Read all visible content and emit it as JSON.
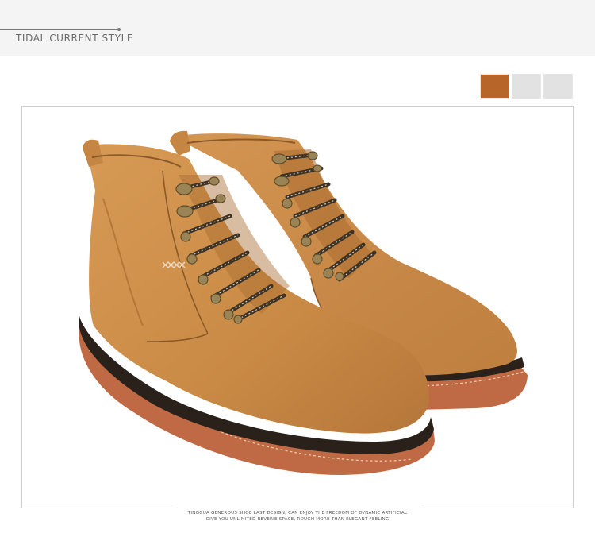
{
  "header": {
    "title": "TIDAL CURRENT STYLE"
  },
  "color_options": [
    {
      "name": "tan",
      "color": "#b8652a"
    },
    {
      "name": "light-gray-1",
      "color": "#e2e2e2"
    },
    {
      "name": "light-gray-2",
      "color": "#e2e2e2"
    }
  ],
  "product_image": {
    "subject": "pair of tan suede lace-up martin boots with gum soles"
  },
  "caption": {
    "line1": "TINGGUA GENEROUS SHOE LAST DESIGN, CAN ENJOY THE FREEDOM OF DYNAMIC ARTIFICIAL",
    "line2": "GIVE YOU UNLIMITED REVERIE SPACE, ROUGH MORE THAN ELEGANT FEELING"
  },
  "colors": {
    "leather": "#c98a45",
    "leather_shade": "#a96c30",
    "sole": "#c06a45",
    "welt": "#2a211b",
    "lace": "#3d3328",
    "eyelet": "#9a8455",
    "header_bg": "#f4f4f4"
  }
}
